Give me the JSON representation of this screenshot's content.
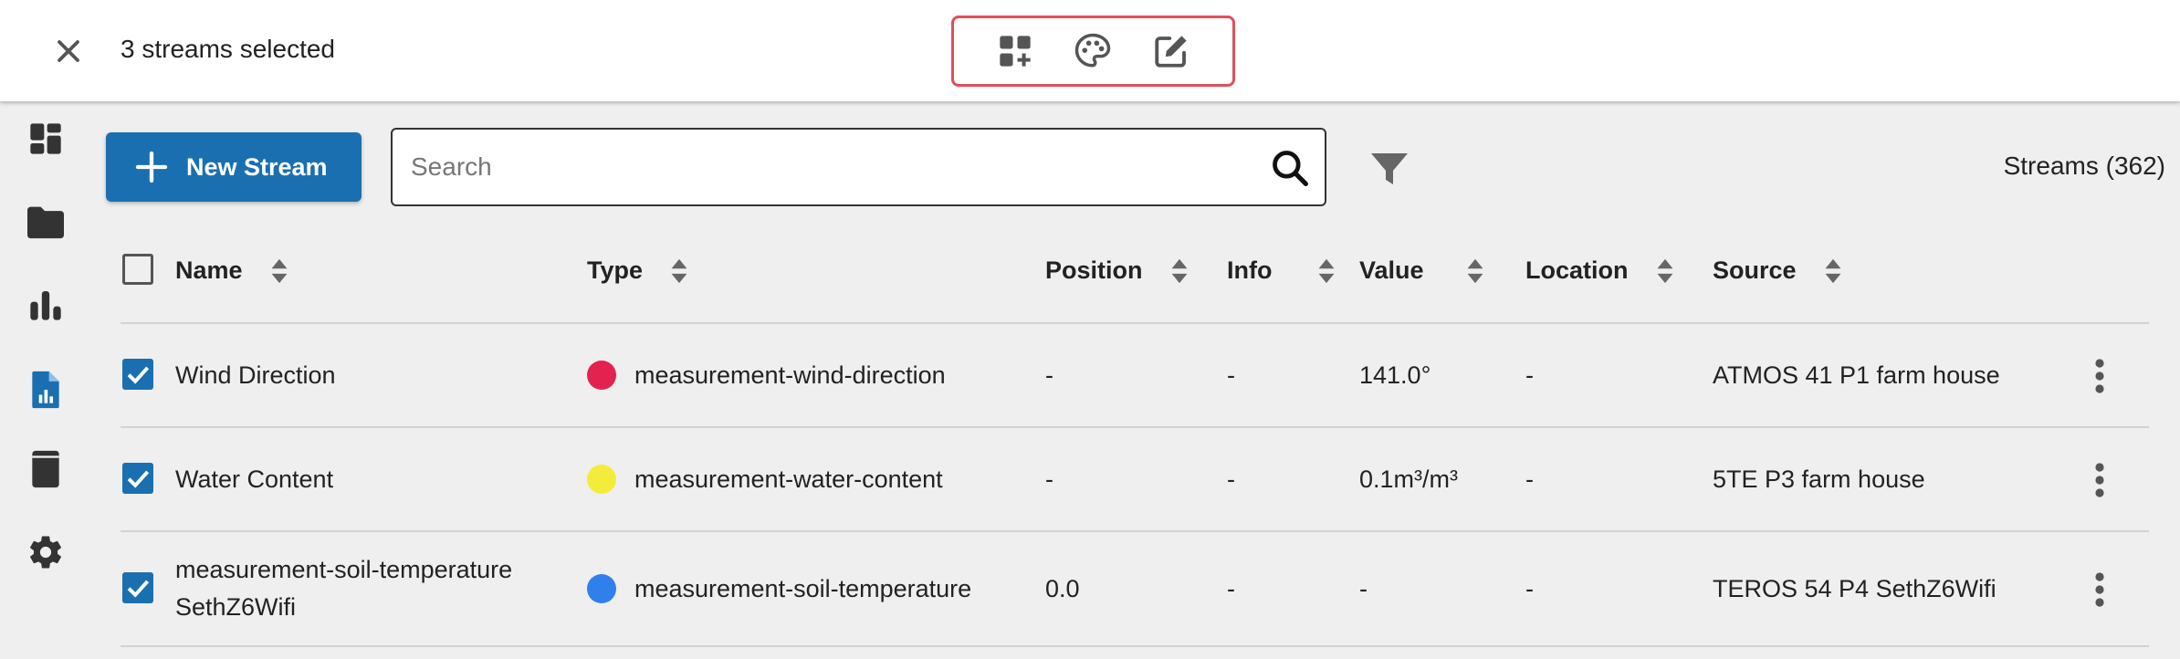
{
  "selection": {
    "text": "3 streams selected"
  },
  "toolbar": {
    "new_stream_label": "New Stream",
    "search_placeholder": "Search",
    "search_value": "",
    "count_label": "Streams (362)"
  },
  "table": {
    "headers": {
      "name": "Name",
      "type": "Type",
      "position": "Position",
      "info": "Info",
      "value": "Value",
      "location": "Location",
      "source": "Source"
    },
    "rows": [
      {
        "name": "Wind Direction",
        "type": "measurement-wind-direction",
        "type_color": "#e3224f",
        "position": "-",
        "info": "-",
        "value": "141.0°",
        "location": "-",
        "source": "ATMOS 41 P1 farm house"
      },
      {
        "name": "Water Content",
        "type": "measurement-water-content",
        "type_color": "#f3ec3b",
        "position": "-",
        "info": "-",
        "value": "0.1m³/m³",
        "location": "-",
        "source": "5TE P3 farm house"
      },
      {
        "name_line1": "measurement-soil-temperature",
        "name_line2": "SethZ6Wifi",
        "type": "measurement-soil-temperature",
        "type_color": "#2f80ed",
        "position": "0.0",
        "info": "-",
        "value": "-",
        "location": "-",
        "source": "TEROS 54 P4 SethZ6Wifi"
      }
    ]
  },
  "colors": {
    "accent": "#1a6fb0",
    "highlight_border": "#e0505a"
  },
  "icons": {
    "close": "close-icon",
    "add_to_dashboard": "dashboard-add-icon",
    "palette": "palette-icon",
    "edit": "edit-icon",
    "nav": [
      "dashboard-icon",
      "folder-icon",
      "bar-chart-icon",
      "stream-file-icon",
      "device-icon",
      "gear-icon"
    ]
  }
}
